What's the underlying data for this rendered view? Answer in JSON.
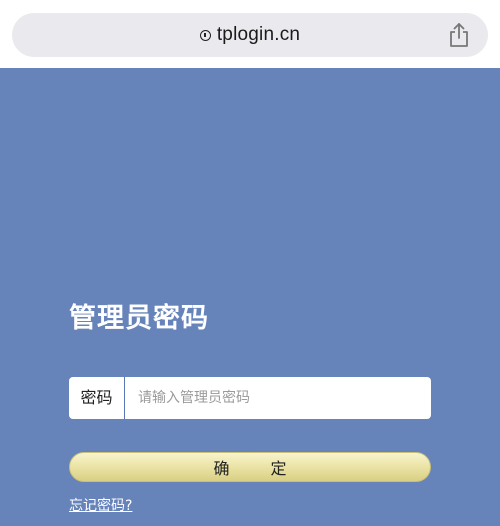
{
  "browser": {
    "url": "tplogin.cn"
  },
  "login": {
    "title": "管理员密码",
    "password_label": "密码",
    "password_placeholder": "请输入管理员密码",
    "password_value": "",
    "confirm_label": "确 定",
    "forgot_link": "忘记密码?"
  },
  "colors": {
    "background": "#6683ba",
    "button_gradient_top": "#f8f4cf",
    "button_gradient_bottom": "#d9cf83"
  }
}
